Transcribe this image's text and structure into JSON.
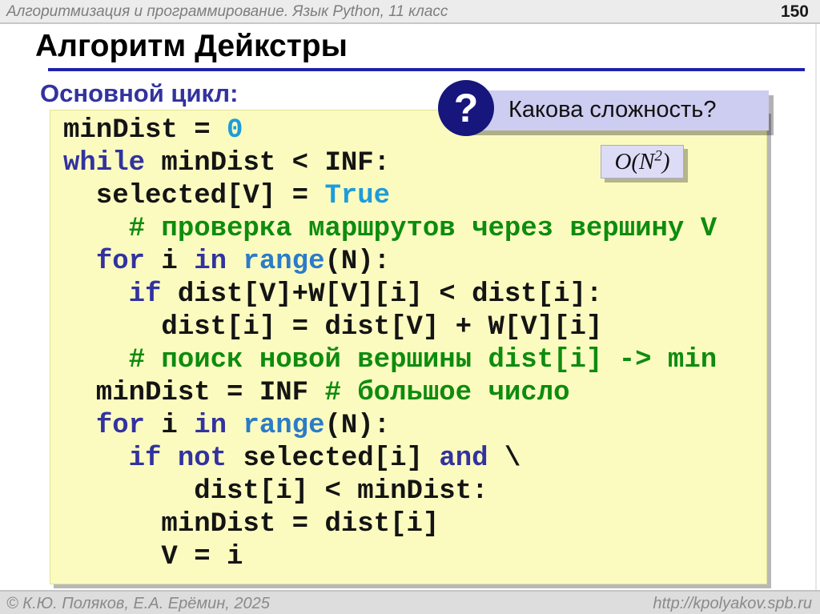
{
  "header": {
    "title": "Алгоритмизация и программирование. Язык Python, 11 класс",
    "page_number": "150"
  },
  "slide": {
    "title": "Алгоритм Дейкстры",
    "subtitle": "Основной цикл:"
  },
  "question": {
    "mark": "?",
    "label": "Какова сложность?",
    "complexity_prefix": "O(N",
    "complexity_sup": "2",
    "complexity_suffix": ")"
  },
  "code": {
    "lines": [
      [
        {
          "t": "minDist = ",
          "c": "pl"
        },
        {
          "t": "0",
          "c": "num"
        }
      ],
      [
        {
          "t": "while",
          "c": "kw"
        },
        {
          "t": " minDist < INF:",
          "c": "pl"
        }
      ],
      [
        {
          "t": "  selected[V] = ",
          "c": "pl"
        },
        {
          "t": "True",
          "c": "num"
        }
      ],
      [
        {
          "t": "    # проверка маршрутов через вершину V",
          "c": "com"
        }
      ],
      [
        {
          "t": "  ",
          "c": "pl"
        },
        {
          "t": "for",
          "c": "kw"
        },
        {
          "t": " i ",
          "c": "pl"
        },
        {
          "t": "in",
          "c": "kw"
        },
        {
          "t": " ",
          "c": "pl"
        },
        {
          "t": "range",
          "c": "fn"
        },
        {
          "t": "(N):",
          "c": "pl"
        }
      ],
      [
        {
          "t": "    ",
          "c": "pl"
        },
        {
          "t": "if",
          "c": "kw"
        },
        {
          "t": " dist[V]+W[V][i] < dist[i]:",
          "c": "pl"
        }
      ],
      [
        {
          "t": "      dist[i] = dist[V] + W[V][i]",
          "c": "pl"
        }
      ],
      [
        {
          "t": "    # поиск новой вершины dist[i] -> min",
          "c": "com"
        }
      ],
      [
        {
          "t": "  minDist = INF ",
          "c": "pl"
        },
        {
          "t": "# большое число",
          "c": "com"
        }
      ],
      [
        {
          "t": "  ",
          "c": "pl"
        },
        {
          "t": "for",
          "c": "kw"
        },
        {
          "t": " i ",
          "c": "pl"
        },
        {
          "t": "in",
          "c": "kw"
        },
        {
          "t": " ",
          "c": "pl"
        },
        {
          "t": "range",
          "c": "fn"
        },
        {
          "t": "(N):",
          "c": "pl"
        }
      ],
      [
        {
          "t": "    ",
          "c": "pl"
        },
        {
          "t": "if",
          "c": "kw"
        },
        {
          "t": " ",
          "c": "pl"
        },
        {
          "t": "not",
          "c": "kw"
        },
        {
          "t": " selected[i] ",
          "c": "pl"
        },
        {
          "t": "and",
          "c": "kw"
        },
        {
          "t": " \\",
          "c": "pl"
        }
      ],
      [
        {
          "t": "        dist[i] < minDist:",
          "c": "pl"
        }
      ],
      [
        {
          "t": "      minDist = dist[i]",
          "c": "pl"
        }
      ],
      [
        {
          "t": "      V = i",
          "c": "pl"
        }
      ]
    ]
  },
  "footer": {
    "copyright": "© К.Ю. Поляков, Е.А. Ерёмин, 2025",
    "url": "http://kpolyakov.spb.ru"
  },
  "colors": {
    "accent_navy": "#2121ac",
    "code_background": "#fbfbc0",
    "keyword": "#3232a0",
    "constant": "#1e9cd8",
    "builtin": "#2b7bc8",
    "comment": "#0e8c0e",
    "callout_background": "#cdcdf1",
    "badge_background": "#16167d"
  }
}
